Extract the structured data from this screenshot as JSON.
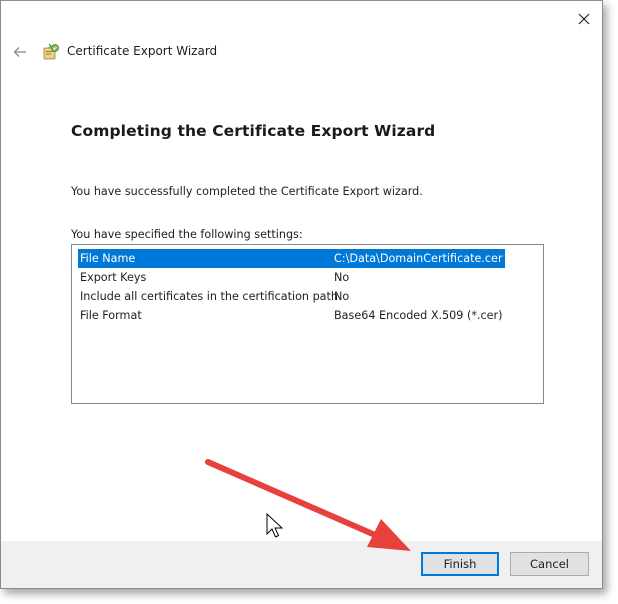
{
  "window": {
    "title": "Certificate Export Wizard",
    "close_label": "Close"
  },
  "main": {
    "heading": "Completing the Certificate Export Wizard",
    "success_text": "You have successfully completed the Certificate Export wizard.",
    "settings_label": "You have specified the following settings:",
    "settings": [
      {
        "key": "File Name",
        "value": "C:\\Data\\DomainCertificate.cer",
        "selected": true
      },
      {
        "key": "Export Keys",
        "value": "No"
      },
      {
        "key": "Include all certificates in the certification path",
        "value": "No"
      },
      {
        "key": "File Format",
        "value": "Base64 Encoded X.509 (*.cer)"
      }
    ]
  },
  "footer": {
    "finish_label": "Finish",
    "cancel_label": "Cancel"
  },
  "colors": {
    "selection": "#0078d7",
    "annotation_arrow": "#e8413c"
  },
  "icons": {
    "back": "back-arrow-icon",
    "wizard": "certificate-wizard-icon",
    "close": "close-icon",
    "cursor": "mouse-pointer-icon"
  }
}
